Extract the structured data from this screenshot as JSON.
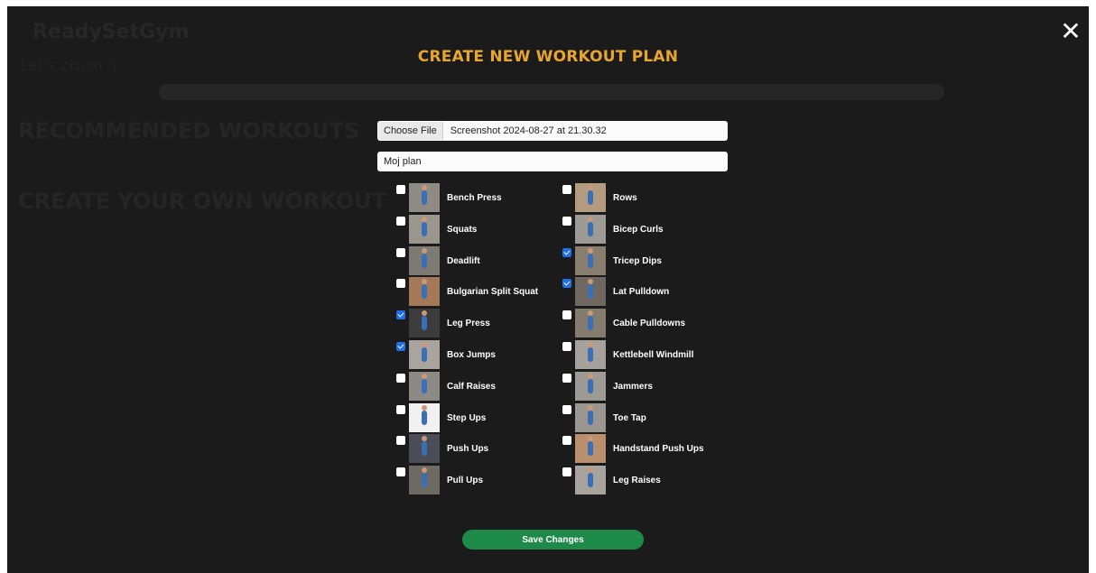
{
  "background_page": {
    "brand": "ReadySetGym",
    "greeting": "Let's crush it",
    "recommended_heading": "RECOMMENDED WORKOUTS",
    "create_heading": "CREATE YOUR OWN WORKOUT"
  },
  "modal": {
    "close_glyph": "✕",
    "title": "CREATE NEW WORKOUT PLAN",
    "file": {
      "button_label": "Choose File",
      "file_name": "Screenshot 2024-08-27 at 21.30.32"
    },
    "plan_name_value": "Moj plan",
    "save_label": "Save Changes"
  },
  "exercises_left": [
    {
      "label": "Bench Press",
      "checked": false,
      "thumb_bg": "#8f8a84"
    },
    {
      "label": "Squats",
      "checked": false,
      "thumb_bg": "#9a958d"
    },
    {
      "label": "Deadlift",
      "checked": false,
      "thumb_bg": "#7d7a74"
    },
    {
      "label": "Bulgarian Split Squat",
      "checked": false,
      "thumb_bg": "#a4795a"
    },
    {
      "label": "Leg Press",
      "checked": true,
      "thumb_bg": "#3c3c3c"
    },
    {
      "label": "Box Jumps",
      "checked": true,
      "thumb_bg": "#a9a59e"
    },
    {
      "label": "Calf Raises",
      "checked": false,
      "thumb_bg": "#8d8a85"
    },
    {
      "label": "Step Ups",
      "checked": false,
      "thumb_bg": "#f1f1f1"
    },
    {
      "label": "Push Ups",
      "checked": false,
      "thumb_bg": "#4a4d55"
    },
    {
      "label": "Pull Ups",
      "checked": false,
      "thumb_bg": "#6d6a63"
    }
  ],
  "exercises_right": [
    {
      "label": "Rows",
      "checked": false,
      "thumb_bg": "#b49a7f"
    },
    {
      "label": "Bicep Curls",
      "checked": false,
      "thumb_bg": "#9e9b95"
    },
    {
      "label": "Tricep Dips",
      "checked": true,
      "thumb_bg": "#8a7e6f"
    },
    {
      "label": "Lat Pulldown",
      "checked": true,
      "thumb_bg": "#6e6860"
    },
    {
      "label": "Cable Pulldowns",
      "checked": false,
      "thumb_bg": "#857c70"
    },
    {
      "label": "Kettlebell Windmill",
      "checked": false,
      "thumb_bg": "#a6a29b"
    },
    {
      "label": "Jammers",
      "checked": false,
      "thumb_bg": "#9d9993"
    },
    {
      "label": "Toe Tap",
      "checked": false,
      "thumb_bg": "#9b9690"
    },
    {
      "label": "Handstand Push Ups",
      "checked": false,
      "thumb_bg": "#b98f6e"
    },
    {
      "label": "Leg Raises",
      "checked": false,
      "thumb_bg": "#a8a49d"
    }
  ],
  "colors": {
    "overlay_bg": "#1b1b1b",
    "title_accent": "#e8a530",
    "checkbox_checked": "#1f6fe8",
    "save_button": "#1e8a4a"
  }
}
